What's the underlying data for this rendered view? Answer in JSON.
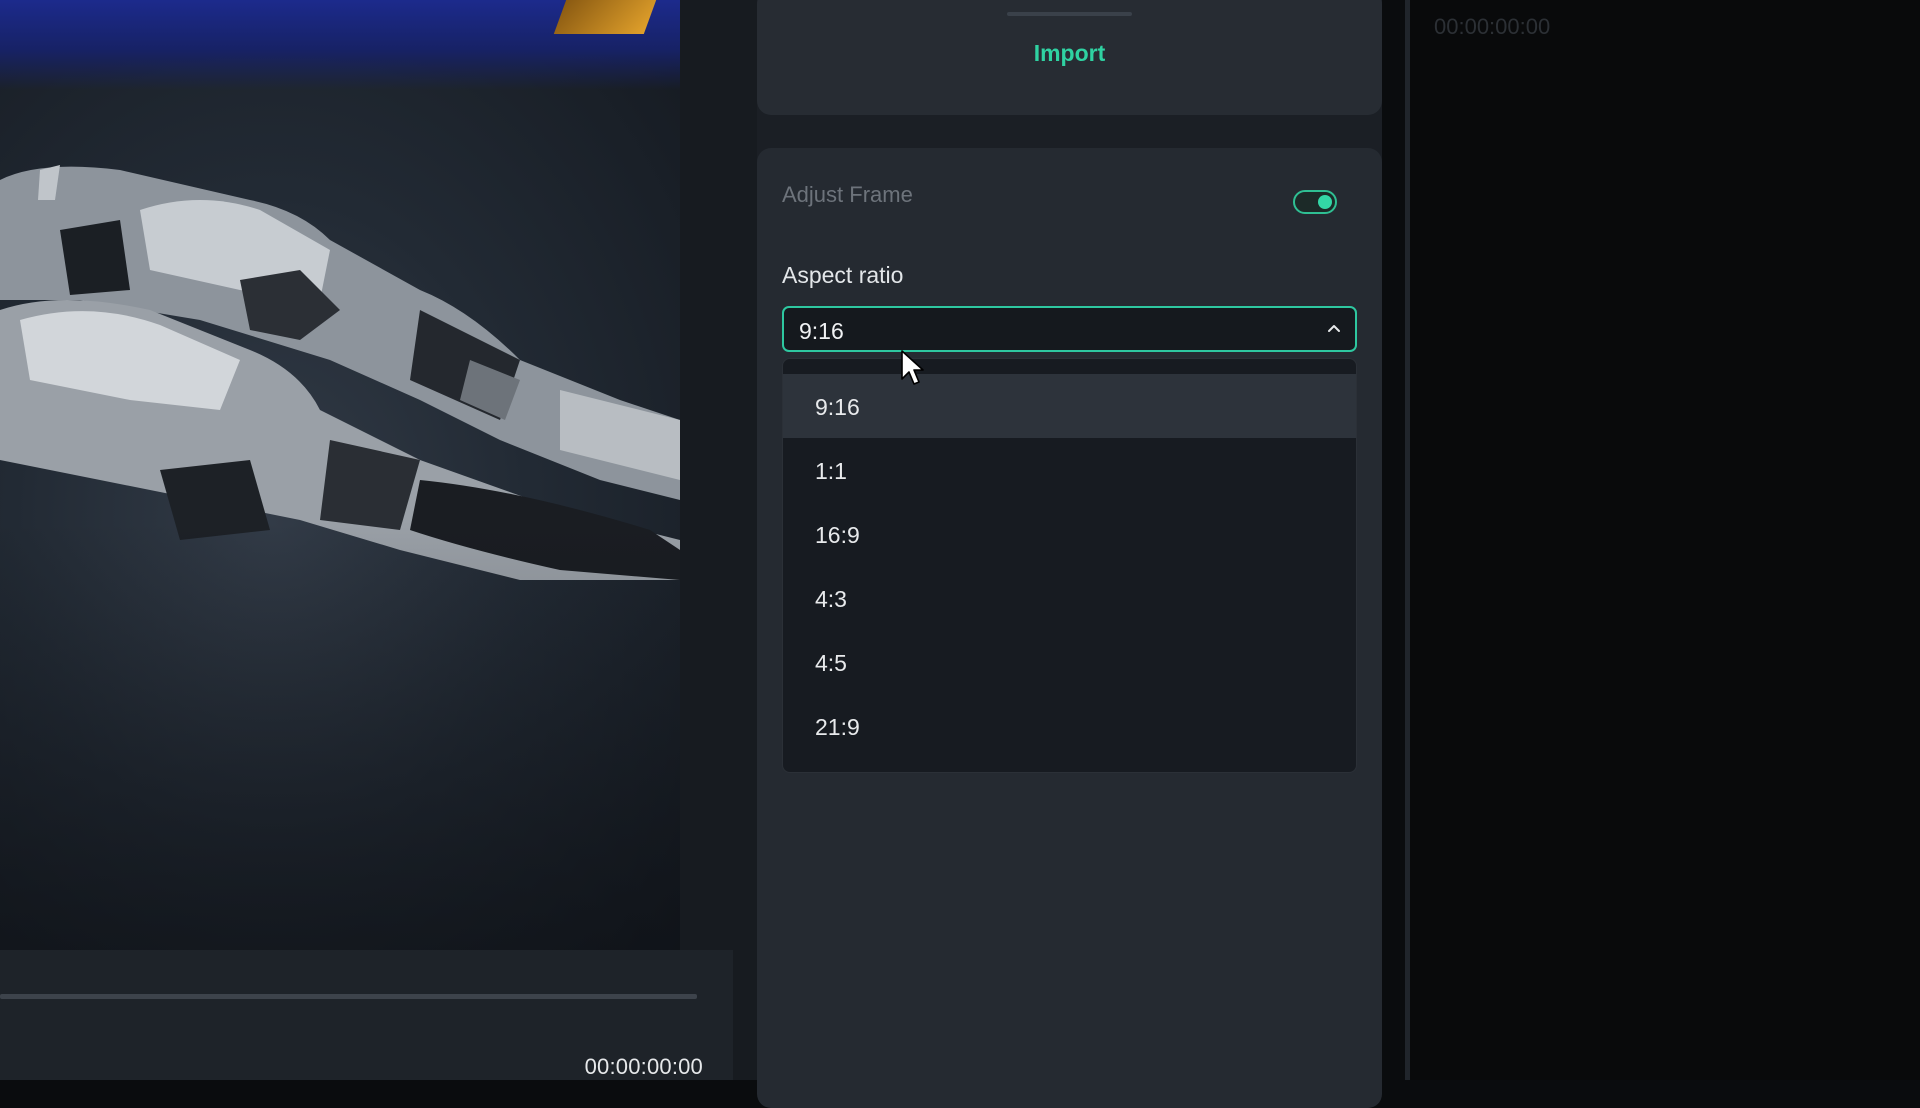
{
  "import_card": {
    "import_label": "Import"
  },
  "adjust_frame": {
    "label": "Adjust Frame",
    "enabled": true,
    "aspect_label": "Aspect ratio",
    "selected": "9:16",
    "options": [
      "9:16",
      "1:1",
      "16:9",
      "4:3",
      "4:5",
      "21:9"
    ]
  },
  "player": {
    "time": "00:00:00:00"
  },
  "timeline": {
    "time": "00:00:00:00"
  },
  "colors": {
    "accent": "#2fd2a2",
    "panel": "#252a31",
    "dropdown_bg": "#171b21",
    "selected_row": "#2d333b"
  }
}
